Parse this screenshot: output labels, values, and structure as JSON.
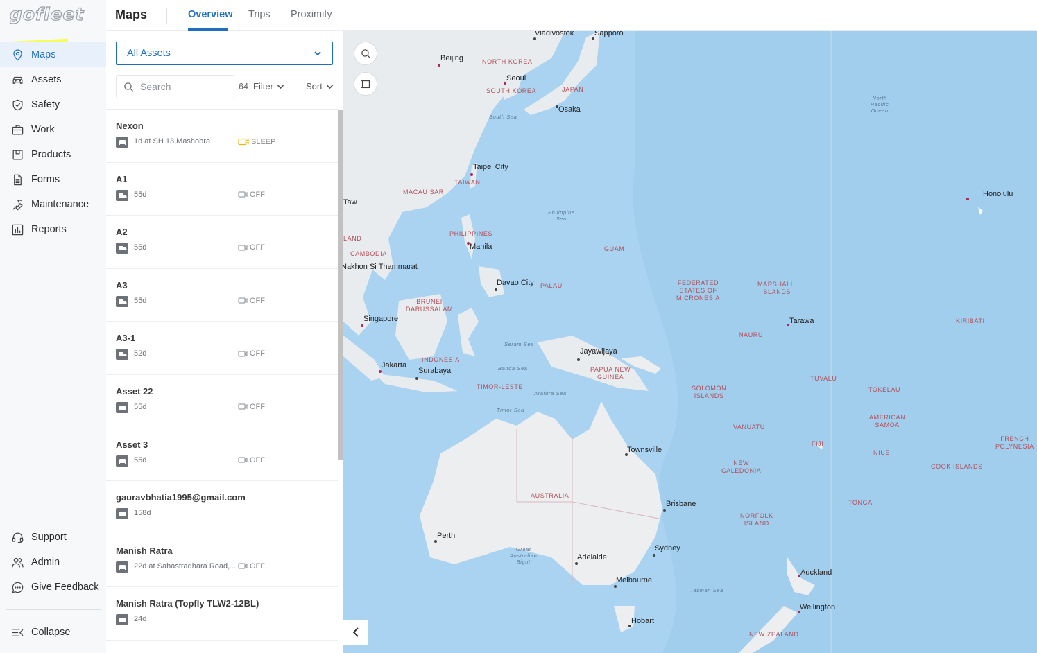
{
  "app": {
    "logo": "gofleet"
  },
  "sidebar": {
    "items": [
      {
        "label": "Maps",
        "icon": "map-pin-icon"
      },
      {
        "label": "Assets",
        "icon": "car-icon"
      },
      {
        "label": "Safety",
        "icon": "shield-icon"
      },
      {
        "label": "Work",
        "icon": "briefcase-icon"
      },
      {
        "label": "Products",
        "icon": "box-icon"
      },
      {
        "label": "Forms",
        "icon": "document-icon"
      },
      {
        "label": "Maintenance",
        "icon": "wrench-icon"
      },
      {
        "label": "Reports",
        "icon": "bar-chart-icon"
      }
    ],
    "bottom": [
      {
        "label": "Support",
        "icon": "headset-icon"
      },
      {
        "label": "Admin",
        "icon": "users-icon"
      },
      {
        "label": "Give Feedback",
        "icon": "chat-icon"
      }
    ],
    "collapse_label": "Collapse"
  },
  "header": {
    "title": "Maps",
    "tabs": [
      {
        "label": "Overview"
      },
      {
        "label": "Trips"
      },
      {
        "label": "Proximity"
      }
    ]
  },
  "panel": {
    "asset_select": "All Assets",
    "search_placeholder": "Search",
    "count": "64",
    "filter_label": "Filter",
    "sort_label": "Sort",
    "assets": [
      {
        "name": "Nexon",
        "info": "1d at SH 13,Mashobra",
        "status": "SLEEP",
        "vehicle": "car"
      },
      {
        "name": "A1",
        "info": "55d",
        "status": "OFF",
        "vehicle": "truck"
      },
      {
        "name": "A2",
        "info": "55d",
        "status": "OFF",
        "vehicle": "truck"
      },
      {
        "name": "A3",
        "info": "55d",
        "status": "OFF",
        "vehicle": "truck"
      },
      {
        "name": "A3-1",
        "info": "52d",
        "status": "OFF",
        "vehicle": "truck"
      },
      {
        "name": "Asset 22",
        "info": "55d",
        "status": "OFF",
        "vehicle": "car"
      },
      {
        "name": "Asset 3",
        "info": "55d",
        "status": "OFF",
        "vehicle": "car"
      },
      {
        "name": "gauravbhatia1995@gmail.com",
        "info": "158d",
        "status": "",
        "vehicle": "car"
      },
      {
        "name": "Manish Ratra",
        "info": "22d at Sahastradhara Road,...",
        "status": "OFF",
        "vehicle": "car"
      },
      {
        "name": "Manish Ratra (Topfly TLW2-12BL)",
        "info": "24d",
        "status": "",
        "vehicle": "car"
      }
    ]
  },
  "map": {
    "cities": [
      "Vladivostok",
      "Sapporo",
      "Beijing",
      "Seoul",
      "Osaka",
      "Taipei City",
      "Taw",
      "Manila",
      "Nakhon Si Thammarat",
      "Davao City",
      "Singapore",
      "Jakarta",
      "Surabaya",
      "Jayawijaya",
      "Honolulu",
      "Tarawa",
      "Townsville",
      "Brisbane",
      "Perth",
      "Adelaide",
      "Sydney",
      "Melbourne",
      "Hobart",
      "Auckland",
      "Wellington"
    ],
    "countries": [
      "NORTH KOREA",
      "SOUTH KOREA",
      "JAPAN",
      "TAIWAN",
      "MACAU SAR",
      "PHILIPPINES",
      "LAND",
      "CAMBODIA",
      "BRUNEI DARUSSALAM",
      "INDONESIA",
      "TIMOR-LESTE",
      "PAPUA NEW GUINEA",
      "GUAM",
      "PALAU",
      "FEDERATED STATES OF MICRONESIA",
      "MARSHALL ISLANDS",
      "NAURU",
      "KIRIBATI",
      "SOLOMON ISLANDS",
      "TUVALU",
      "TOKELAU",
      "AMERICAN SAMOA",
      "VANUATU",
      "FIJI",
      "NIUE",
      "TONGA",
      "COOK ISLANDS",
      "FRENCH POLYNESIA",
      "NEW CALEDONIA",
      "AUSTRALIA",
      "NORFOLK ISLAND",
      "NEW ZEALAND"
    ],
    "seas": [
      "South Sea",
      "Philippine Sea",
      "North Pacific Ocean",
      "Seram Sea",
      "Banda Sea",
      "Arafura Sea",
      "Timor Sea",
      "Great Australian Bight",
      "Tasman Sea"
    ]
  }
}
